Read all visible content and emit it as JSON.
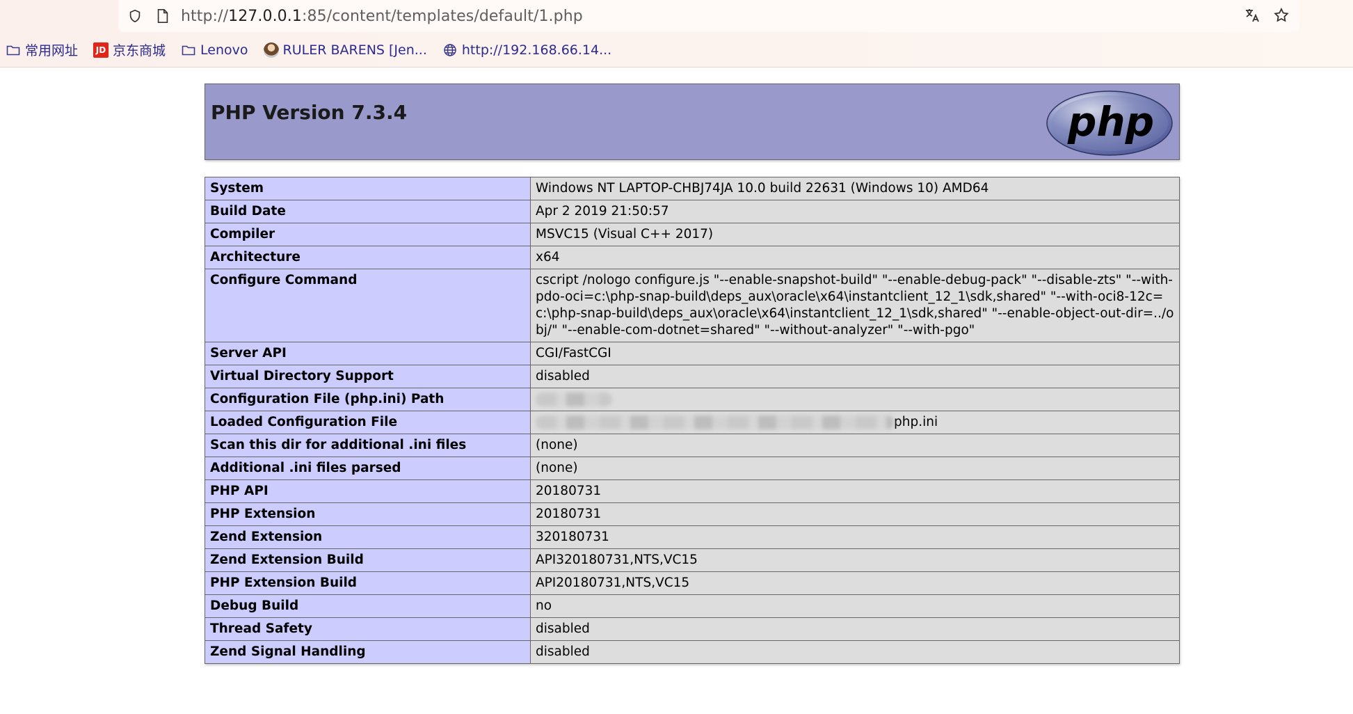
{
  "browser": {
    "url_prefix": "http://",
    "url_host": "127.0.0.1",
    "url_rest": ":85/content/templates/default/1.php",
    "icons": {
      "left": [
        "shield-icon",
        "page-icon"
      ],
      "right": [
        "translate-icon",
        "star-icon"
      ]
    }
  },
  "bookmarks": [
    {
      "label": "常用网址",
      "icon": "folder-icon"
    },
    {
      "label": "京东商城",
      "icon": "jd-icon",
      "badge": "JD"
    },
    {
      "label": "Lenovo",
      "icon": "folder-icon"
    },
    {
      "label": "RULER BARENS [Jen...",
      "icon": "avatar-icon"
    },
    {
      "label": "http://192.168.66.14...",
      "icon": "globe-icon"
    }
  ],
  "php": {
    "title": "PHP Version 7.3.4",
    "logo_text": "php",
    "colors": {
      "header": "#9999cc",
      "key_cell": "#ccccff",
      "value_cell": "#dddddd"
    }
  },
  "rows": [
    {
      "key": "System",
      "value": "Windows NT LAPTOP-CHBJ74JA 10.0 build 22631 (Windows 10) AMD64"
    },
    {
      "key": "Build Date",
      "value": "Apr 2 2019 21:50:57"
    },
    {
      "key": "Compiler",
      "value": "MSVC15 (Visual C++ 2017)"
    },
    {
      "key": "Architecture",
      "value": "x64"
    },
    {
      "key": "Configure Command",
      "value": "cscript /nologo configure.js \"--enable-snapshot-build\" \"--enable-debug-pack\" \"--disable-zts\" \"--with-pdo-oci=c:\\php-snap-build\\deps_aux\\oracle\\x64\\instantclient_12_1\\sdk,shared\" \"--with-oci8-12c=c:\\php-snap-build\\deps_aux\\oracle\\x64\\instantclient_12_1\\sdk,shared\" \"--enable-object-out-dir=../obj/\" \"--enable-com-dotnet=shared\" \"--without-analyzer\" \"--with-pgo\""
    },
    {
      "key": "Server API",
      "value": "CGI/FastCGI"
    },
    {
      "key": "Virtual Directory Support",
      "value": "disabled"
    },
    {
      "key": "Configuration File (php.ini) Path",
      "value": ""
    },
    {
      "key": "Loaded Configuration File",
      "value": "php.ini"
    },
    {
      "key": "Scan this dir for additional .ini files",
      "value": "(none)"
    },
    {
      "key": "Additional .ini files parsed",
      "value": "(none)"
    },
    {
      "key": "PHP API",
      "value": "20180731"
    },
    {
      "key": "PHP Extension",
      "value": "20180731"
    },
    {
      "key": "Zend Extension",
      "value": "320180731"
    },
    {
      "key": "Zend Extension Build",
      "value": "API320180731,NTS,VC15"
    },
    {
      "key": "PHP Extension Build",
      "value": "API20180731,NTS,VC15"
    },
    {
      "key": "Debug Build",
      "value": "no"
    },
    {
      "key": "Thread Safety",
      "value": "disabled"
    },
    {
      "key": "Zend Signal Handling",
      "value": "disabled"
    }
  ]
}
